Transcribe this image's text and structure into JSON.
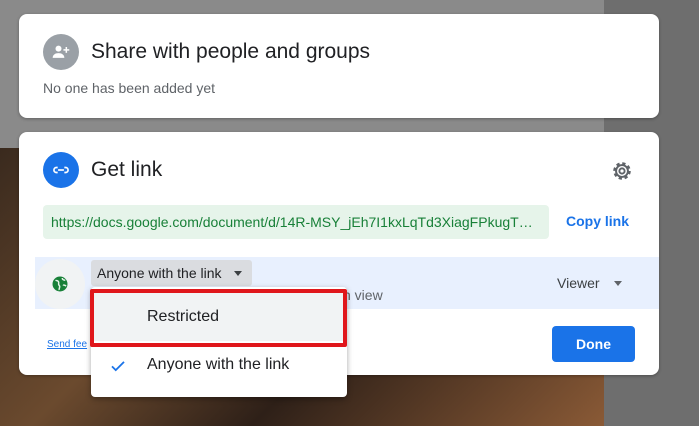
{
  "share": {
    "title": "Share with people and groups",
    "subtitle": "No one has been added yet"
  },
  "get_link": {
    "title": "Get link",
    "url": "https://docs.google.com/document/d/14R-MSY_jEh7I1kxLqTd3XiagFPkugT…",
    "copy_label": "Copy link",
    "access_label": "Anyone with the link",
    "access_desc_fragment": "n view",
    "role_label": "Viewer",
    "send_feedback": "Send fee",
    "done_label": "Done"
  },
  "menu": {
    "items": [
      {
        "label": "Restricted",
        "selected": false
      },
      {
        "label": "Anyone with the link",
        "selected": true
      }
    ]
  },
  "colors": {
    "accent": "#1a73e8",
    "link_green": "#188038",
    "highlight_red": "#e0161b"
  }
}
